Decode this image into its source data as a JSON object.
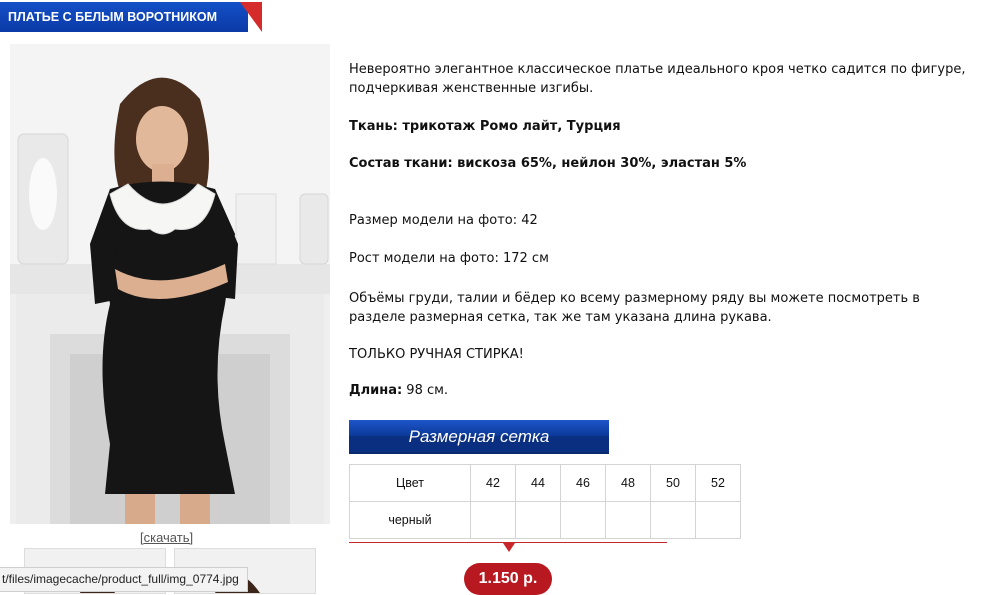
{
  "title": "ПЛАТЬЕ С БЕЛЫМ ВОРОТНИКОМ",
  "download_link": "[скачать]",
  "url_tooltip": "t/files/imagecache/product_full/img_0774.jpg",
  "description": {
    "intro": "Невероятно элегантное классическое платье идеального кроя четко садится по фигуре, подчеркивая женственные изгибы.",
    "fabric": "Ткань: трикотаж Ромо лайт, Турция",
    "composition": "Состав ткани: вискоза 65%, нейлон 30%, эластан 5%",
    "model_size": "Размер модели на фото: 42",
    "model_height": "Рост модели на фото: 172 см",
    "measurements_note": "Объёмы груди, талии и бёдер ко всему размерному ряду вы можете посмотреть в разделе размерная сетка, так же там указана длина рукава.",
    "wash": "ТОЛЬКО РУЧНАЯ СТИРКА!",
    "length_label": "Длина:",
    "length_value": " 98 см."
  },
  "size_chart_button": "Размерная сетка",
  "size_table": {
    "header_label": "Цвет",
    "sizes": [
      "42",
      "44",
      "46",
      "48",
      "50",
      "52"
    ],
    "rows": [
      {
        "color": "черный",
        "cells": [
          "",
          "",
          "",
          "",
          "",
          ""
        ]
      }
    ]
  },
  "price": "1.150 р.",
  "colors": {
    "title_bar": "#0b3aa6",
    "accent_red": "#c9262c",
    "price_badge": "#b8181f"
  }
}
